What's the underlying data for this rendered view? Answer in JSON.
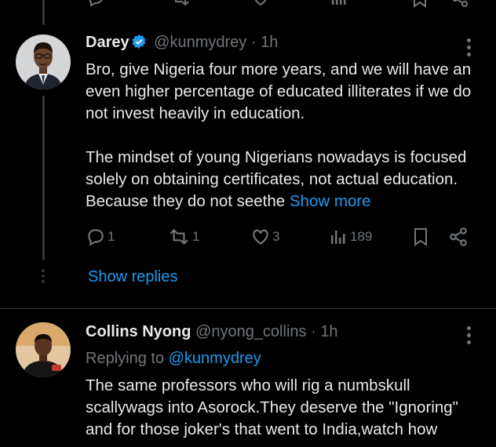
{
  "top_actions": [
    "reply-icon",
    "retweet-icon",
    "like-icon",
    "views-icon",
    "bookmark-icon",
    "share-icon"
  ],
  "tweets": [
    {
      "name": "Darey",
      "verified": true,
      "handle": "@kunmydrey",
      "separator": "·",
      "time": "1h",
      "paragraphs": [
        "Bro, give Nigeria four more years, and we will have an even higher percentage of educated illiterates if we do not invest heavily in education.",
        "The mindset of young Nigerians nowadays is focused solely on obtaining certificates, not actual education. Because they do not seethe"
      ],
      "show_more": "Show more",
      "stats": {
        "replies": "1",
        "reposts": "1",
        "likes": "3",
        "views": "189"
      },
      "show_replies": "Show replies"
    },
    {
      "name": "Collins Nyong",
      "verified": false,
      "handle": "@nyong_collins",
      "separator": "·",
      "time": "1h",
      "replying_label": "Replying to",
      "replying_to": "@kunmydrey",
      "text_lines": [
        "The same professors who will rig a numbskull",
        "scallywags into Asorock.They deserve the \"Ignoring\"",
        "and for those joker's that went to India,watch how"
      ]
    }
  ],
  "colors": {
    "background": "#000000",
    "text": "#e7e9ea",
    "muted": "#71767b",
    "accent": "#1d9bf0"
  }
}
